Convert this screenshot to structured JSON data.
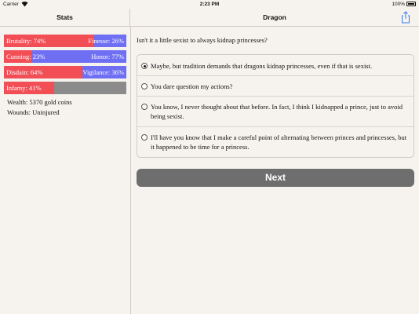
{
  "status_bar": {
    "carrier": "Carrier",
    "time": "2:23 PM",
    "battery": "100%"
  },
  "left_panel": {
    "title": "Stats",
    "bars": [
      {
        "left": "Brutality: 74%",
        "right": "Finesse: 26%",
        "left_value": 0.74,
        "right_value": 0.26,
        "left_color": "#f24e56",
        "right_color": "#6f6ff3"
      },
      {
        "left": "Cunning: 23%",
        "right": "Honor: 77%",
        "left_value": 0.23,
        "right_value": 0.77,
        "left_color": "#f24e56",
        "right_color": "#6f6ff3"
      },
      {
        "left": "Disdain: 64%",
        "right": "Vigilance: 36%",
        "left_value": 0.64,
        "right_value": 0.36,
        "left_color": "#f24e56",
        "right_color": "#6f6ff3"
      },
      {
        "left": "Infamy: 41%",
        "right": "",
        "left_value": 0.41,
        "right_value": 0.59,
        "left_color": "#f24e56",
        "right_color": "#8b8b8b"
      }
    ],
    "wealth": "Wealth: 5370 gold coins",
    "wounds": "Wounds: Uninjured"
  },
  "right_panel": {
    "title": "Dragon",
    "share_icon": "share-icon",
    "question": "Isn't it a little sexist to always kidnap princesses?",
    "choices": [
      {
        "text": "Maybe, but tradition demands that dragons kidnap princesses, even if that is sexist.",
        "selected": true
      },
      {
        "text": "You dare question my actions?",
        "selected": false
      },
      {
        "text": "You know, I never thought about that before. In fact, I think I kidnapped a prince, just to avoid being sexist.",
        "selected": false
      },
      {
        "text": "I'll have you know that I make a careful point of alternating between princes and princesses, but it happened to be time for a princess.",
        "selected": false
      }
    ],
    "next_label": "Next"
  }
}
